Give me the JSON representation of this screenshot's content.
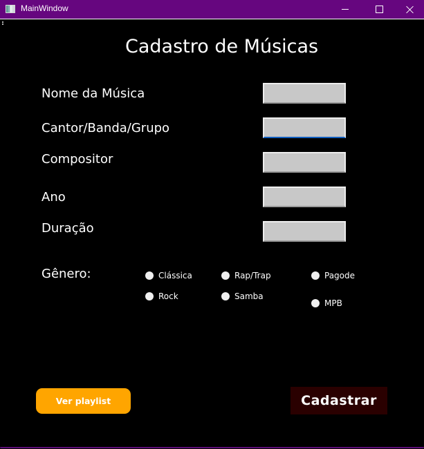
{
  "window": {
    "title": "MainWindow",
    "titlebar_color": "#66067f",
    "controls": {
      "minimize": "minimize-icon",
      "maximize": "maximize-icon",
      "close": "close-icon"
    }
  },
  "form": {
    "heading": "Cadastro de Músicas",
    "fields": [
      {
        "label": "Nome da Música",
        "value": "",
        "focused": false
      },
      {
        "label": "Cantor/Banda/Grupo",
        "value": "",
        "focused": true
      },
      {
        "label": "Compositor",
        "value": "",
        "focused": false
      },
      {
        "label": "Ano",
        "value": "",
        "focused": false
      },
      {
        "label": "Duração",
        "value": "",
        "focused": false
      }
    ],
    "genre": {
      "label": "Gênero:",
      "options": [
        {
          "label": "Clássica",
          "checked": false
        },
        {
          "label": "Rap/Trap",
          "checked": false
        },
        {
          "label": "Pagode",
          "checked": false
        },
        {
          "label": "Rock",
          "checked": false
        },
        {
          "label": "Samba",
          "checked": false
        },
        {
          "label": "MPB",
          "checked": false
        }
      ]
    }
  },
  "actions": {
    "playlist_label": "Ver playlist",
    "playlist_color": "#ffa500",
    "submit_label": "Cadastrar",
    "submit_color": "#2a0000"
  }
}
